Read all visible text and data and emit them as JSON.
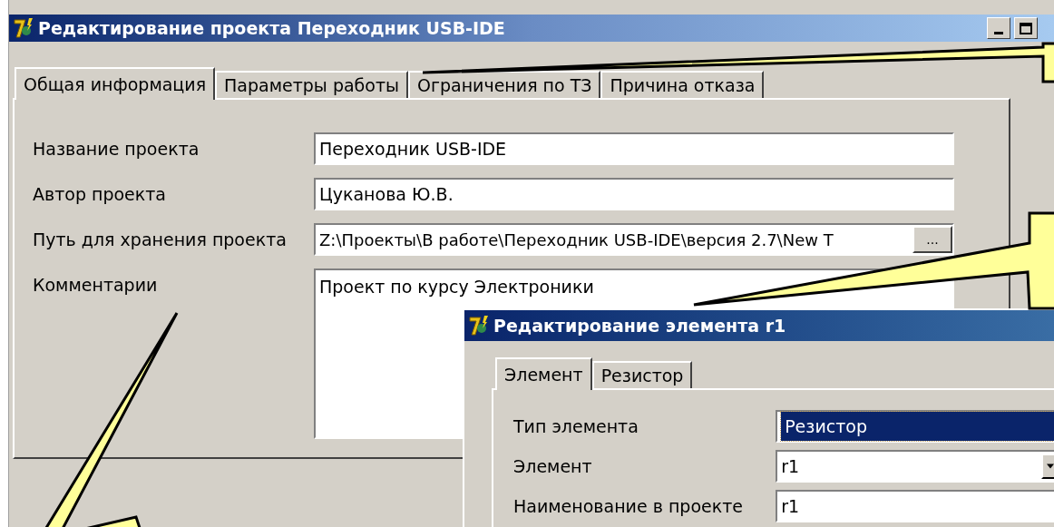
{
  "window": {
    "title": "Редактирование проекта Переходник USB-IDE"
  },
  "tabs": [
    {
      "label": "Общая информация",
      "selected": true
    },
    {
      "label": "Параметры работы",
      "selected": false
    },
    {
      "label": "Ограничения по ТЗ",
      "selected": false
    },
    {
      "label": "Причина отказа",
      "selected": false
    }
  ],
  "fields": [
    {
      "label": "Название проекта",
      "value": "Переходник USB-IDE",
      "kind": "text"
    },
    {
      "label": "Автор проекта",
      "value": "Цуканова Ю.В.",
      "kind": "text"
    },
    {
      "label": "Путь для хранения проекта",
      "value": "Z:\\Проекты\\В работе\\Переходник USB-IDE\\версия 2.7\\New T",
      "kind": "path",
      "button": "..."
    },
    {
      "label": "Комментарии",
      "value": "Проект по курсу Электроники",
      "kind": "memo"
    }
  ],
  "dialog": {
    "title": "Редактирование элемента r1",
    "tabs": [
      {
        "label": "Элемент",
        "selected": true
      },
      {
        "label": "Резистор",
        "selected": false
      }
    ],
    "fields": [
      {
        "label": "Тип элемента",
        "value": "Резистор",
        "kind": "selected"
      },
      {
        "label": "Элемент",
        "value": "r1",
        "kind": "combo"
      },
      {
        "label": "Наименование в проекте",
        "value": "r1",
        "kind": "text"
      }
    ]
  }
}
